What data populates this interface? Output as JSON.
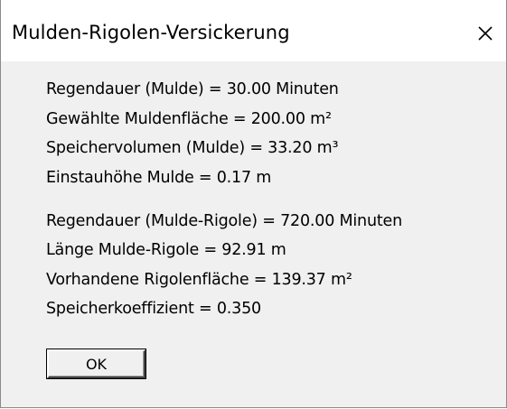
{
  "window": {
    "title": "Mulden-Rigolen-Versickerung",
    "close_icon": "close-icon",
    "background": "#f0f0f0"
  },
  "results": {
    "group1": [
      "Regendauer (Mulde) = 30.00 Minuten",
      "Gewählte Muldenfläche = 200.00 m²",
      "Speichervolumen (Mulde) = 33.20 m³",
      "Einstauhöhe Mulde = 0.17 m"
    ],
    "group2": [
      "Regendauer (Mulde-Rigole) = 720.00 Minuten",
      "Länge Mulde-Rigole = 92.91 m",
      "Vorhandene Rigolenfläche = 139.37 m²",
      "Speicherkoeffizient = 0.350"
    ]
  },
  "buttons": {
    "ok_label": "OK"
  }
}
